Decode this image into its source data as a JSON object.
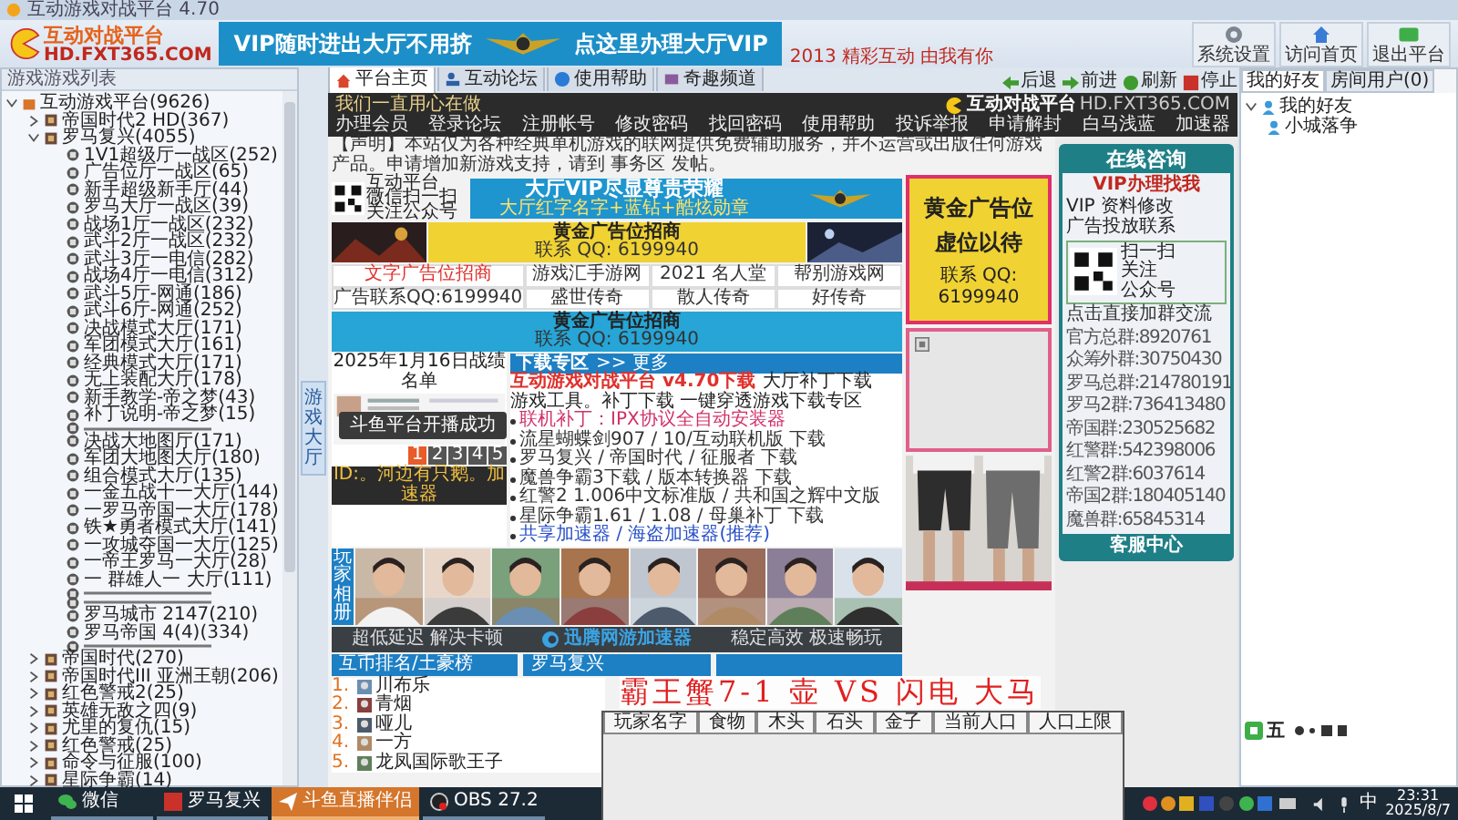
{
  "window": {
    "title": "互动游戏对战平台 4.70"
  },
  "header": {
    "logo_title": "互动对战平台",
    "logo_url": "HD.FXT365.COM",
    "logo_slogan": "2013 精彩互动 由我有你",
    "vip_left": "VIP随时进出大厅不用挤",
    "vip_right": "点这里办理大厅VIP",
    "buttons": [
      {
        "label": "系统设置",
        "kind": "gear"
      },
      {
        "label": "访问首页",
        "kind": "home"
      },
      {
        "label": "退出平台",
        "kind": "exit"
      }
    ]
  },
  "game_list": {
    "title": "游戏游戏列表",
    "side_tab": "游戏大厅",
    "tree": [
      {
        "label": "互动游戏平台(9626)",
        "kind": "folder",
        "expanded": true,
        "children": [
          {
            "label": "帝国时代2 HD(367)",
            "kind": "game",
            "expanded": false
          },
          {
            "label": "罗马复兴(4055)",
            "kind": "game",
            "expanded": true,
            "children": [
              {
                "label": "1V1超级厅一战区(252)",
                "kind": "room"
              },
              {
                "label": "广告位厅一战区(65)",
                "kind": "room"
              },
              {
                "label": "新手超级新手厅(44)",
                "kind": "room"
              },
              {
                "label": "罗马大厅一战区(39)",
                "kind": "room"
              },
              {
                "label": "战场1厅一战区(232)",
                "kind": "room"
              },
              {
                "label": "武斗2厅一战区(232)",
                "kind": "room"
              },
              {
                "label": "武斗3厅一电信(282)",
                "kind": "room"
              },
              {
                "label": "战场4厅一电信(312)",
                "kind": "room"
              },
              {
                "label": "武斗5厅-网通(186)",
                "kind": "room"
              },
              {
                "label": "武斗6厅-网通(252)",
                "kind": "room"
              },
              {
                "label": "决战模式大厅(171)",
                "kind": "room"
              },
              {
                "label": "军团模式大厅(161)",
                "kind": "room"
              },
              {
                "label": "经典模式大厅(171)",
                "kind": "room"
              },
              {
                "label": "无上装配大厅(178)",
                "kind": "room"
              },
              {
                "label": "新手教学-帝之梦(43)",
                "kind": "room"
              },
              {
                "label": "补丁说明-帝之梦(15)",
                "kind": "room"
              },
              {
                "kind": "separator"
              },
              {
                "label": "决战大地图厅(171)",
                "kind": "room"
              },
              {
                "label": "军团大地图大厅(180)",
                "kind": "room"
              },
              {
                "label": "组合模式大厅(135)",
                "kind": "room"
              },
              {
                "label": "一金五战十一大厅(144)",
                "kind": "room"
              },
              {
                "label": "一罗马帝国一大厅(178)",
                "kind": "room"
              },
              {
                "label": "铁★勇者模式大厅(141)",
                "kind": "room"
              },
              {
                "label": "一攻城夺国一大厅(125)",
                "kind": "room"
              },
              {
                "label": "一帝王罗马一大厅(28)",
                "kind": "room"
              },
              {
                "label": "一 群雄人一 大厅(111)",
                "kind": "room"
              },
              {
                "kind": "separator"
              },
              {
                "kind": "separator"
              },
              {
                "label": "罗马城市 2147(210)",
                "kind": "room"
              },
              {
                "label": "罗马帝国 4(4)(334)",
                "kind": "room"
              },
              {
                "kind": "separator"
              }
            ]
          },
          {
            "label": "帝国时代(270)",
            "kind": "game",
            "expanded": false
          },
          {
            "label": "帝国时代III 亚洲王朝(206)",
            "kind": "game",
            "expanded": false
          },
          {
            "label": "红色警戒2(25)",
            "kind": "game",
            "expanded": false
          },
          {
            "label": "英雄无敌之四(9)",
            "kind": "game",
            "expanded": false
          },
          {
            "label": "尤里的复仇(15)",
            "kind": "game",
            "expanded": false
          },
          {
            "label": "红色警戒(25)",
            "kind": "game",
            "expanded": false
          },
          {
            "label": "命令与征服(100)",
            "kind": "game",
            "expanded": false
          },
          {
            "label": "星际争霸(14)",
            "kind": "game",
            "expanded": false
          }
        ]
      }
    ]
  },
  "browser": {
    "tabs": [
      {
        "label": "平台主页",
        "kind": "home",
        "selected": true
      },
      {
        "label": "互动论坛",
        "kind": "people",
        "selected": false
      },
      {
        "label": "使用帮助",
        "kind": "help",
        "selected": false
      },
      {
        "label": "奇趣频道",
        "kind": "film",
        "selected": false
      }
    ],
    "toolbar": [
      {
        "label": "后退",
        "kind": "back"
      },
      {
        "label": "前进",
        "kind": "forward"
      },
      {
        "label": "刷新",
        "kind": "refresh"
      },
      {
        "label": "停止",
        "kind": "stop"
      }
    ]
  },
  "page": {
    "slogan": "我们一直用心在做",
    "nav": [
      "办理会员",
      "登录论坛",
      "注册帐号",
      "修改密码",
      "找回密码",
      "使用帮助",
      "投诉举报",
      "申请解封",
      "白马浅蓝",
      "加速器"
    ],
    "brand": "互动对战平台",
    "brand_url": "HD.FXT365.COM",
    "notice": "【声明】本站仅为各种经典单机游戏的联网提供免费辅助服务，并不运营或出版任何游戏产品。申请增加新游戏支持，请到 事务区 发帖。",
    "qr_caption": [
      "互动平台",
      "微信扫一扫",
      "关注公众号"
    ],
    "vip_title": "大厅VIP尽显尊贵荣耀",
    "vip_sub": "大厅红字名字+蓝钻+酷炫勋章",
    "gold_ad": {
      "title": "黄金广告位招商",
      "contact": "联系 QQ: 6199940"
    },
    "links": [
      {
        "label": "文字广告位招商",
        "color": "#e0302c"
      },
      {
        "label": "游戏汇手游网",
        "color": "#333333"
      },
      {
        "label": "2021 名人堂",
        "color": "#333333"
      },
      {
        "label": "帮别游戏网",
        "color": "#333333"
      },
      {
        "label": "广告联系QQ:6199940",
        "color": "#333333"
      },
      {
        "label": "盛世传奇",
        "color": "#333333"
      },
      {
        "label": "散人传奇",
        "color": "#333333"
      },
      {
        "label": "好传奇",
        "color": "#333333"
      }
    ],
    "gold_bar": {
      "title": "黄金广告位招商",
      "contact": "联系 QQ: 6199940"
    },
    "ranking": {
      "title": "2025年1月16日战绩名单",
      "pages": [
        {
          "label": "1",
          "selected": true
        },
        {
          "label": "2",
          "selected": false
        },
        {
          "label": "3",
          "selected": false
        },
        {
          "label": "4",
          "selected": false
        },
        {
          "label": "5",
          "selected": false
        }
      ],
      "caption": "ID:。河边有只鹅。加速器"
    },
    "downloads": {
      "title": "下载专区",
      "more": ">> 更多",
      "headline": "互动游戏对战平台 v4.70下载",
      "headline_extra": "大厅补丁下载",
      "subline": "游戏工具。补丁下载  一键穿透游戏下载专区",
      "items": [
        {
          "text": "联机补丁：IPX协议全自动安装器",
          "kind": "hot"
        },
        {
          "text": "流星蝴蝶剑907 / 10/互动联机版 下载",
          "kind": "normal"
        },
        {
          "text": "罗马复兴 / 帝国时代 / 征服者 下载",
          "kind": "normal"
        },
        {
          "text": "魔兽争霸3下载 / 版本转换器 下载",
          "kind": "normal"
        },
        {
          "text": "红警2 1.006中文标准版 / 共和国之辉中文版",
          "kind": "normal"
        },
        {
          "text": "星际争霸1.61 / 1.08 / 母巢补丁 下载",
          "kind": "normal"
        },
        {
          "text": "共享加速器 / 海盗加速器(推荐)",
          "kind": "link"
        }
      ]
    },
    "album_label": "玩家相册",
    "players": [
      {
        "kind": "picture"
      },
      {
        "kind": "picture"
      },
      {
        "kind": "picture"
      },
      {
        "kind": "picture"
      },
      {
        "kind": "picture"
      },
      {
        "kind": "picture"
      },
      {
        "kind": "picture"
      },
      {
        "kind": "picture"
      }
    ],
    "accel": {
      "left": "超低延迟 解决卡顿",
      "name": "迅腾网游加速器",
      "right": "稳定高效 极速畅玩"
    },
    "bottom_tabs": [
      "互币排名/土豪榜",
      "罗马复兴"
    ],
    "rank_list": [
      {
        "num": "1.",
        "name": "川布乐"
      },
      {
        "num": "2.",
        "name": "青烟"
      },
      {
        "num": "3.",
        "name": "哑儿"
      },
      {
        "num": "4.",
        "name": "一方"
      },
      {
        "num": "5.",
        "name": "龙凤国际歌王子"
      }
    ],
    "side_ad": {
      "line1": "黄金广告位",
      "line2": "虚位以待",
      "contact": "联系 QQ: 6199940"
    }
  },
  "consult": {
    "title": "在线咨询",
    "vip_title": "VIP办理找我",
    "contacts": [
      "VIP 资料修改",
      "广告投放联系"
    ],
    "qr_text": [
      "扫一扫",
      "关注",
      "公众号"
    ],
    "groups_title": "点击直接加群交流",
    "groups": [
      {
        "name": "官方总群:",
        "id": "8920761"
      },
      {
        "name": "众筹外群:",
        "id": "30750430"
      },
      {
        "name": "罗马总群:",
        "id": "214780191"
      },
      {
        "name": "罗马2群:",
        "id": "736413480"
      },
      {
        "name": "帝国群:",
        "id": "230525682"
      },
      {
        "name": "红警群:",
        "id": "542398006"
      },
      {
        "name": "红警2群:",
        "id": "6037614"
      },
      {
        "name": "帝国2群:",
        "id": "180405140"
      },
      {
        "name": "魔兽群:",
        "id": "65845314"
      }
    ],
    "footer": "客服中心"
  },
  "friends": {
    "tabs": [
      {
        "label": "我的好友",
        "selected": true
      },
      {
        "label": "房间用户(0)",
        "selected": false
      }
    ],
    "tree": [
      {
        "label": "我的好友",
        "expanded": true,
        "children": [
          {
            "label": "小城落争"
          }
        ]
      }
    ]
  },
  "ime": {
    "mode": "五"
  },
  "toast": "斗鱼平台开播成功",
  "stream_caption": "霸王蟹7-1 壶 VS 闪电 大马",
  "stats_table": {
    "columns": [
      "玩家名字",
      "食物",
      "木头",
      "石头",
      "金子",
      "当前人口",
      "人口上限"
    ]
  },
  "taskbar": {
    "apps": [
      {
        "label": "微信",
        "kind": "wechat",
        "selected": false
      },
      {
        "label": "罗马复兴",
        "kind": "game",
        "selected": false
      },
      {
        "label": "斗鱼直播伴侣",
        "kind": "live",
        "selected": true
      },
      {
        "label": "OBS 27.2",
        "kind": "obs",
        "selected": false
      }
    ],
    "lang": "中",
    "time": "23:31",
    "date": "2025/8/7"
  }
}
